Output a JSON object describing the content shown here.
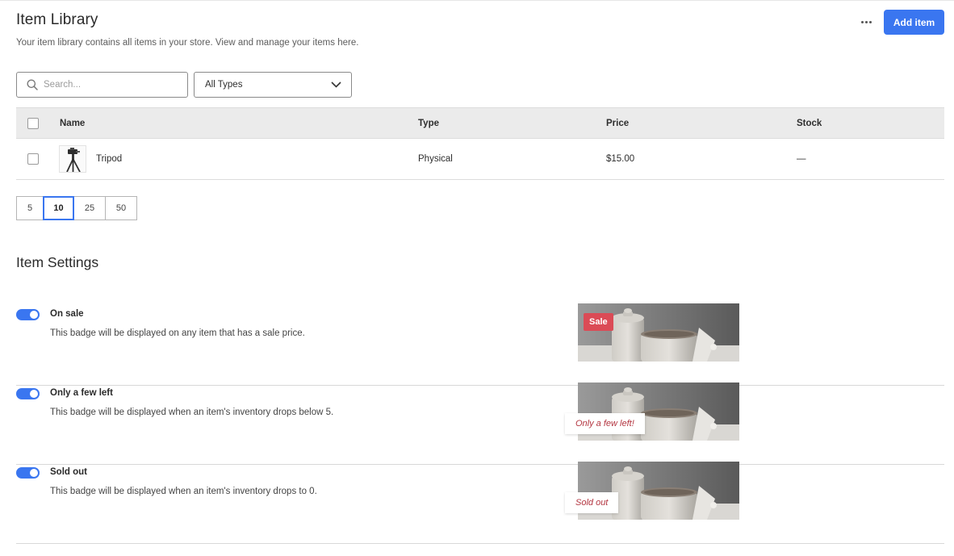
{
  "header": {
    "title": "Item Library",
    "subtitle": "Your item library contains all items in your store. View and manage your items here.",
    "more_icon": "more-horizontal-icon",
    "add_button": "Add item",
    "accent_color": "#3a76f0"
  },
  "filters": {
    "search_placeholder": "Search...",
    "search_value": "",
    "type_selected": "All Types"
  },
  "table": {
    "columns": [
      "Name",
      "Type",
      "Price",
      "Stock"
    ],
    "rows": [
      {
        "name": "Tripod",
        "type": "Physical",
        "price": "$15.00",
        "stock": "—",
        "thumbnail_icon": "tripod-image"
      }
    ]
  },
  "pagination": {
    "options": [
      "5",
      "10",
      "25",
      "50"
    ],
    "selected": "10"
  },
  "settings": {
    "title": "Item Settings",
    "items": [
      {
        "label": "On sale",
        "description": "This badge will be displayed on any item that has a sale price.",
        "enabled": true,
        "badge": "Sale"
      },
      {
        "label": "Only a few left",
        "description": "This badge will be displayed when an item's inventory drops below 5.",
        "enabled": true,
        "badge": "Only a few left!"
      },
      {
        "label": "Sold out",
        "description": "This badge will be displayed when an item's inventory drops to 0.",
        "enabled": true,
        "badge": "Sold out"
      }
    ],
    "sale_badge_color": "#db4b56"
  }
}
